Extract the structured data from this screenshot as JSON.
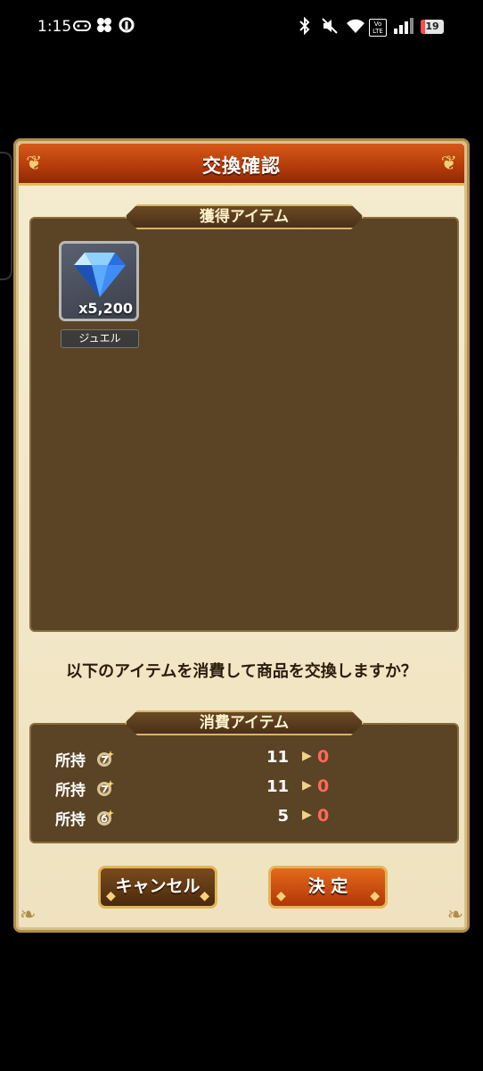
{
  "status_bar": {
    "time": "1:15",
    "volte": "Vo LTE",
    "battery": "19",
    "battery_level": 0.19
  },
  "dialog": {
    "title": "交換確認",
    "acquire_section_title": "獲得アイテム",
    "acquired_items": [
      {
        "name": "ジュエル",
        "quantity": "x5,200",
        "icon": "blue-gem-icon"
      }
    ],
    "prompt": "以下のアイテムを消費して商品を交換しますか？",
    "consume_section_title": "消費アイテム",
    "consumed_items": [
      {
        "label": "所持",
        "icon": "medal-7-icon",
        "have": "11",
        "after": "0"
      },
      {
        "label": "所持",
        "icon": "medal-7-icon",
        "have": "11",
        "after": "0"
      },
      {
        "label": "所持",
        "icon": "medal-6-icon",
        "have": "5",
        "after": "0"
      }
    ],
    "cancel_label": "キャンセル",
    "confirm_label": "決 定"
  },
  "colors": {
    "header": "#c2460f",
    "panel": "#5b4325",
    "dialog_bg": "#f2e7c8",
    "after_value": "#ff6a5a"
  }
}
